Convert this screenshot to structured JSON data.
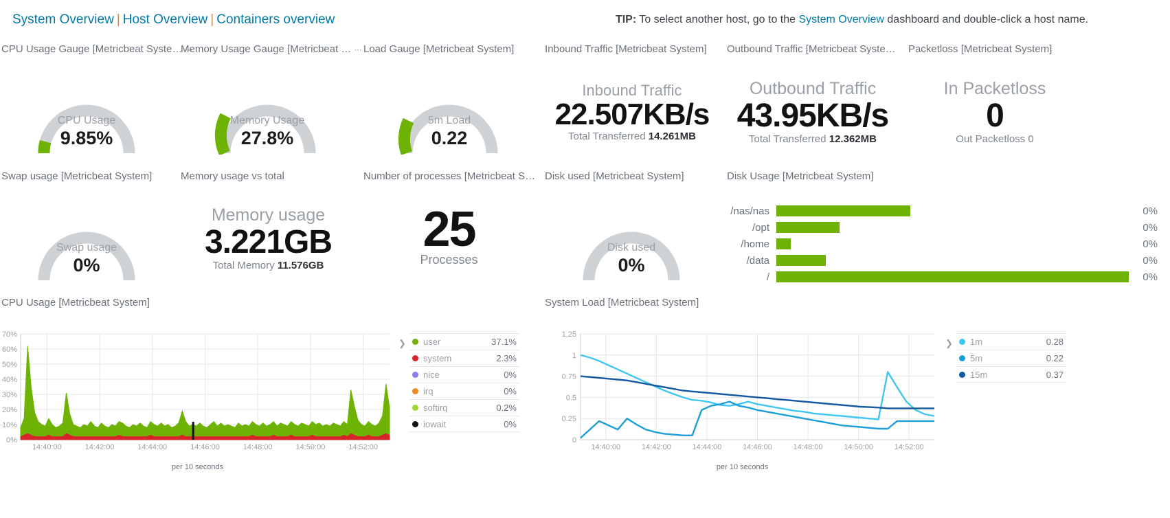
{
  "nav": {
    "links": [
      "System Overview",
      "Host Overview",
      "Containers overview"
    ],
    "separator": "|"
  },
  "tip": {
    "prefix": "TIP:",
    "text_before": " To select another host, go to the ",
    "link": "System Overview",
    "text_after": " dashboard and double-click a host name."
  },
  "panels": {
    "cpu_gauge_title": "CPU Usage Gauge [Metricbeat Syste…",
    "memory_gauge_title": "Memory Usage Gauge [Metricbeat …",
    "load_gauge_title": "Load Gauge [Metricbeat System]",
    "inbound_title": "Inbound Traffic [Metricbeat System]",
    "outbound_title": "Outbound Traffic [Metricbeat Syste…",
    "packetloss_title": "Packetloss [Metricbeat System]",
    "swap_title": "Swap usage [Metricbeat System]",
    "memvstotal_title": "Memory usage vs total",
    "processes_title": "Number of processes [Metricbeat S…",
    "diskused_title": "Disk used [Metricbeat System]",
    "diskusage_title": "Disk Usage [Metricbeat System]",
    "cpuusage_title": "CPU Usage [Metricbeat System]",
    "systemload_title": "System Load [Metricbeat System]",
    "menu_dots": "⋯"
  },
  "gauges": [
    {
      "label": "CPU Usage",
      "value": "9.85%",
      "pct": 9.85
    },
    {
      "label": "Memory Usage",
      "value": "27.8%",
      "pct": 27.8
    },
    {
      "label": "5m Load",
      "value": "0.22",
      "pct": 22
    },
    {
      "label": "Swap usage",
      "value": "0%",
      "pct": 0
    },
    {
      "label": "Disk used",
      "value": "0%",
      "pct": 0
    }
  ],
  "metrics": {
    "inbound": {
      "label": "Inbound Traffic",
      "value": "22.507KB/s",
      "sub_label": "Total Transferred",
      "sub_value": "14.261MB"
    },
    "outbound": {
      "label": "Outbound Traffic",
      "value": "43.95KB/s",
      "sub_label": "Total Transferred",
      "sub_value": "12.362MB"
    },
    "packetloss": {
      "label": "In Packetloss",
      "value": "0",
      "sub_label": "Out Packetloss",
      "sub_value": "0"
    },
    "memory": {
      "label": "Memory usage",
      "value": "3.221GB",
      "sub_label": "Total Memory",
      "sub_value": "11.576GB"
    },
    "processes": {
      "value": "25",
      "sub_label": "Processes"
    }
  },
  "chart_data": [
    {
      "type": "bar",
      "orientation": "horizontal",
      "title": "Disk Usage [Metricbeat System]",
      "categories": [
        "/nas/nas",
        "/opt",
        "/home",
        "/data",
        "/"
      ],
      "values": [
        38,
        18,
        4,
        14,
        100
      ],
      "value_labels": [
        "0%",
        "0%",
        "0%",
        "0%",
        "0%"
      ],
      "color": "#6eb204",
      "xlim": [
        0,
        100
      ]
    },
    {
      "type": "area",
      "title": "CPU Usage [Metricbeat System]",
      "xlabel": "per 10 seconds",
      "ylabel": "",
      "ylim": [
        0,
        70
      ],
      "yticks": [
        "0%",
        "10%",
        "20%",
        "30%",
        "40%",
        "50%",
        "60%",
        "70%"
      ],
      "xticks": [
        "14:40:00",
        "14:42:00",
        "14:44:00",
        "14:46:00",
        "14:48:00",
        "14:50:00",
        "14:52:00"
      ],
      "grid": true,
      "legend_position": "right",
      "series": [
        {
          "name": "user",
          "color": "#6eb204",
          "legend_value": "37.1%",
          "values": [
            8,
            14,
            62,
            35,
            18,
            12,
            10,
            9,
            14,
            10,
            8,
            9,
            11,
            31,
            17,
            10,
            9,
            8,
            10,
            9,
            12,
            9,
            8,
            11,
            9,
            8,
            10,
            9,
            12,
            11,
            9,
            8,
            10,
            9,
            11,
            9,
            8,
            12,
            10,
            9,
            11,
            9,
            10,
            8,
            9,
            11,
            19,
            12,
            9,
            10,
            9,
            11,
            9,
            8,
            10,
            12,
            9,
            11,
            9,
            10,
            9,
            8,
            11,
            9,
            10,
            9,
            12,
            10,
            9,
            11,
            9,
            10,
            12,
            9,
            11,
            10,
            9,
            12,
            10,
            9,
            11,
            10,
            9,
            12,
            10,
            11,
            9,
            10,
            9,
            11,
            10,
            9,
            12,
            10,
            33,
            22,
            13,
            10,
            9,
            12,
            10,
            9,
            11,
            16,
            37,
            21
          ]
        },
        {
          "name": "system",
          "color": "#d7242b",
          "legend_value": "2.3%",
          "values": [
            2,
            3,
            4,
            3,
            2,
            2,
            2,
            2,
            3,
            2,
            2,
            2,
            2,
            4,
            3,
            2,
            2,
            2,
            2,
            2,
            2,
            2,
            2,
            2,
            2,
            2,
            2,
            2,
            3,
            2,
            2,
            2,
            2,
            2,
            2,
            2,
            2,
            3,
            2,
            2,
            2,
            2,
            2,
            2,
            2,
            2,
            3,
            2,
            2,
            2,
            2,
            2,
            2,
            2,
            2,
            2,
            2,
            2,
            2,
            2,
            2,
            2,
            2,
            2,
            2,
            2,
            3,
            2,
            2,
            2,
            2,
            2,
            3,
            2,
            2,
            2,
            2,
            3,
            2,
            2,
            2,
            2,
            2,
            3,
            2,
            2,
            2,
            2,
            2,
            2,
            2,
            2,
            3,
            2,
            4,
            3,
            2,
            2,
            2,
            3,
            2,
            2,
            2,
            3,
            4,
            3
          ]
        },
        {
          "name": "nice",
          "color": "#8e7ce8",
          "legend_value": "0%",
          "values": []
        },
        {
          "name": "irq",
          "color": "#ef8a24",
          "legend_value": "0%",
          "values": []
        },
        {
          "name": "softirq",
          "color": "#9fd434",
          "legend_value": "0.2%",
          "values": []
        },
        {
          "name": "iowait",
          "color": "#111111",
          "legend_value": "0%",
          "values": []
        }
      ]
    },
    {
      "type": "line",
      "title": "System Load [Metricbeat System]",
      "xlabel": "per 10 seconds",
      "ylabel": "",
      "ylim": [
        0,
        1.25
      ],
      "yticks": [
        "0",
        "0.25",
        "0.5",
        "0.75",
        "1",
        "1.25"
      ],
      "xticks": [
        "14:40:00",
        "14:42:00",
        "14:44:00",
        "14:46:00",
        "14:48:00",
        "14:50:00",
        "14:52:00"
      ],
      "grid": true,
      "legend_position": "right",
      "series": [
        {
          "name": "1m",
          "color": "#41c5f2",
          "legend_value": "0.28",
          "values": [
            1.0,
            0.97,
            0.93,
            0.88,
            0.83,
            0.78,
            0.73,
            0.68,
            0.63,
            0.58,
            0.54,
            0.5,
            0.47,
            0.46,
            0.44,
            0.41,
            0.4,
            0.42,
            0.45,
            0.42,
            0.4,
            0.38,
            0.36,
            0.34,
            0.33,
            0.31,
            0.3,
            0.29,
            0.28,
            0.27,
            0.26,
            0.25,
            0.24,
            0.8,
            0.62,
            0.45,
            0.35,
            0.3,
            0.28
          ]
        },
        {
          "name": "5m",
          "color": "#1c9fd6",
          "legend_value": "0.22",
          "values": [
            0.02,
            0.12,
            0.22,
            0.17,
            0.12,
            0.25,
            0.18,
            0.12,
            0.09,
            0.07,
            0.06,
            0.05,
            0.05,
            0.35,
            0.4,
            0.42,
            0.45,
            0.4,
            0.38,
            0.35,
            0.33,
            0.31,
            0.29,
            0.27,
            0.25,
            0.23,
            0.21,
            0.19,
            0.17,
            0.16,
            0.15,
            0.14,
            0.13,
            0.13,
            0.22,
            0.22,
            0.22,
            0.22,
            0.22
          ]
        },
        {
          "name": "15m",
          "color": "#1158a0",
          "legend_value": "0.37",
          "values": [
            0.75,
            0.74,
            0.73,
            0.72,
            0.71,
            0.7,
            0.68,
            0.66,
            0.64,
            0.62,
            0.6,
            0.58,
            0.57,
            0.56,
            0.55,
            0.54,
            0.53,
            0.52,
            0.51,
            0.5,
            0.49,
            0.48,
            0.47,
            0.46,
            0.45,
            0.44,
            0.43,
            0.42,
            0.41,
            0.4,
            0.39,
            0.385,
            0.38,
            0.37,
            0.37,
            0.37,
            0.37,
            0.37,
            0.37
          ]
        }
      ]
    }
  ]
}
